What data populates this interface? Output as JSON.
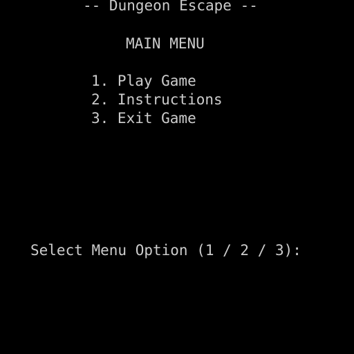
{
  "screen": {
    "title": "-- Dungeon Escape --",
    "menu_heading": "MAIN MENU",
    "options": [
      {
        "label": "1. Play Game"
      },
      {
        "label": "2. Instructions"
      },
      {
        "label": "3. Exit Game"
      }
    ],
    "prompt": "Select Menu Option (1 / 2 / 3):",
    "input_value": ""
  },
  "colors": {
    "background": "#000000",
    "text": "#cccccc"
  }
}
